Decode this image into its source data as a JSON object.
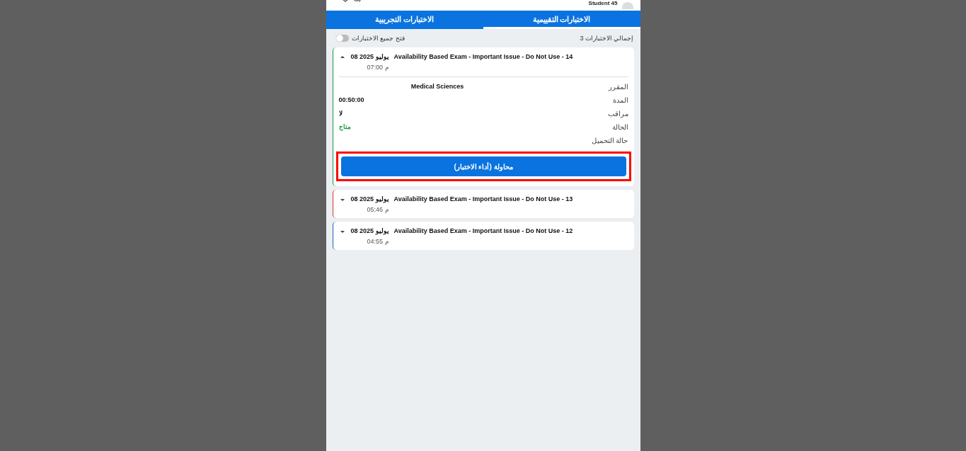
{
  "header": {
    "user": "Student 45"
  },
  "tabs": [
    {
      "label": "الاختبارات التقييمية",
      "selected": true
    },
    {
      "label": "الاختبارات التجريبية",
      "selected": false
    }
  ],
  "summary": {
    "total": "إجمالي الاختبارات 3",
    "toggle_label": "فتح جميع الاختبارات",
    "toggle_on": false
  },
  "exams": [
    {
      "title": "Availability Based Exam - Important Issue - Do Not Use - 14",
      "date": "08 يوليو 2025",
      "time": "07:00 م",
      "color": "#1a9a3a",
      "expanded": true,
      "details": [
        {
          "label": "المقرر",
          "value": "Medical Sciences"
        },
        {
          "label": "المدة",
          "value": "00:50:00"
        },
        {
          "label": "مراقب",
          "value": "لا"
        },
        {
          "label": "الحالة",
          "value": "متاح",
          "color": "#1a9a3a"
        },
        {
          "label": "حالة التحميل"
        }
      ],
      "button": {
        "label": "محاولة (أداء الاختبار)",
        "highlighted": true
      }
    },
    {
      "title": "Availability Based Exam - Important Issue - Do Not Use - 13",
      "date": "08 يوليو 2025",
      "time": "05:46 م",
      "color": "#d9302c",
      "expanded": false
    },
    {
      "title": "Availability Based Exam - Important Issue - Do Not Use - 12",
      "date": "08 يوليو 2025",
      "time": "04:55 م",
      "color": "#1f5fbf",
      "expanded": false
    }
  ]
}
